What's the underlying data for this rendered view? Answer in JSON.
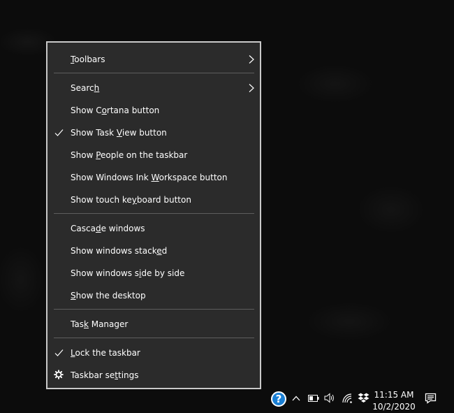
{
  "menu": {
    "items": [
      {
        "id": "toolbars",
        "pre": "",
        "u": "T",
        "post": "oolbars",
        "submenu": true,
        "checked": false
      },
      {
        "id": "search",
        "pre": "Searc",
        "u": "h",
        "post": "",
        "submenu": true,
        "checked": false
      },
      {
        "id": "cortana",
        "pre": "Show C",
        "u": "o",
        "post": "rtana button",
        "submenu": false,
        "checked": false
      },
      {
        "id": "task-view",
        "pre": "Show Task ",
        "u": "V",
        "post": "iew button",
        "submenu": false,
        "checked": true
      },
      {
        "id": "people",
        "pre": "Show ",
        "u": "P",
        "post": "eople on the taskbar",
        "submenu": false,
        "checked": false
      },
      {
        "id": "ink",
        "pre": "Show Windows Ink ",
        "u": "W",
        "post": "orkspace button",
        "submenu": false,
        "checked": false
      },
      {
        "id": "touch-keyboard",
        "pre": "Show touch ke",
        "u": "y",
        "post": "board button",
        "submenu": false,
        "checked": false
      },
      {
        "id": "cascade",
        "pre": "Casca",
        "u": "d",
        "post": "e windows",
        "submenu": false,
        "checked": false
      },
      {
        "id": "stacked",
        "pre": "Show windows stack",
        "u": "e",
        "post": "d",
        "submenu": false,
        "checked": false
      },
      {
        "id": "side-by-side",
        "pre": "Show windows s",
        "u": "i",
        "post": "de by side",
        "submenu": false,
        "checked": false
      },
      {
        "id": "desktop",
        "pre": "",
        "u": "S",
        "post": "how the desktop",
        "submenu": false,
        "checked": false
      },
      {
        "id": "task-manager",
        "pre": "Tas",
        "u": "k",
        "post": " Manager",
        "submenu": false,
        "checked": false
      },
      {
        "id": "lock",
        "pre": "",
        "u": "L",
        "post": "ock the taskbar",
        "submenu": false,
        "checked": true
      },
      {
        "id": "settings",
        "pre": "Taskbar se",
        "u": "t",
        "post": "tings",
        "submenu": false,
        "checked": false
      }
    ]
  },
  "tray": {
    "help_glyph": "?",
    "time": "11:15 AM",
    "date": "10/2/2020"
  },
  "colors": {
    "menu_bg": "#2b2b2b",
    "menu_border": "#c9c9c9",
    "separator": "#5e5e5e",
    "text": "#ffffff",
    "help_blue": "#1a7fd4"
  }
}
